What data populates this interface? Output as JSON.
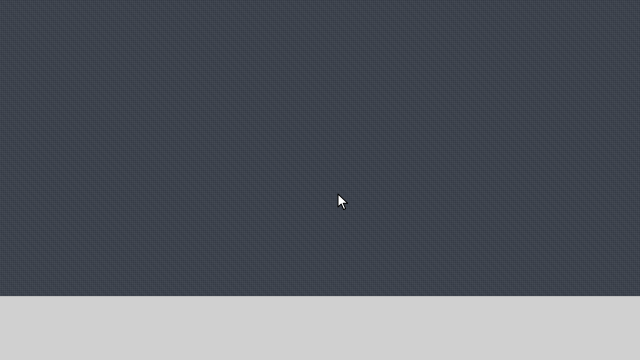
{
  "desktop": {
    "wallpaper_color": "#3a404b",
    "wallpaper_pattern": "linen-texture"
  },
  "bottom_panel": {
    "background_color": "#d0d0d0"
  },
  "cursor": {
    "icon": "mouse-pointer-icon"
  }
}
